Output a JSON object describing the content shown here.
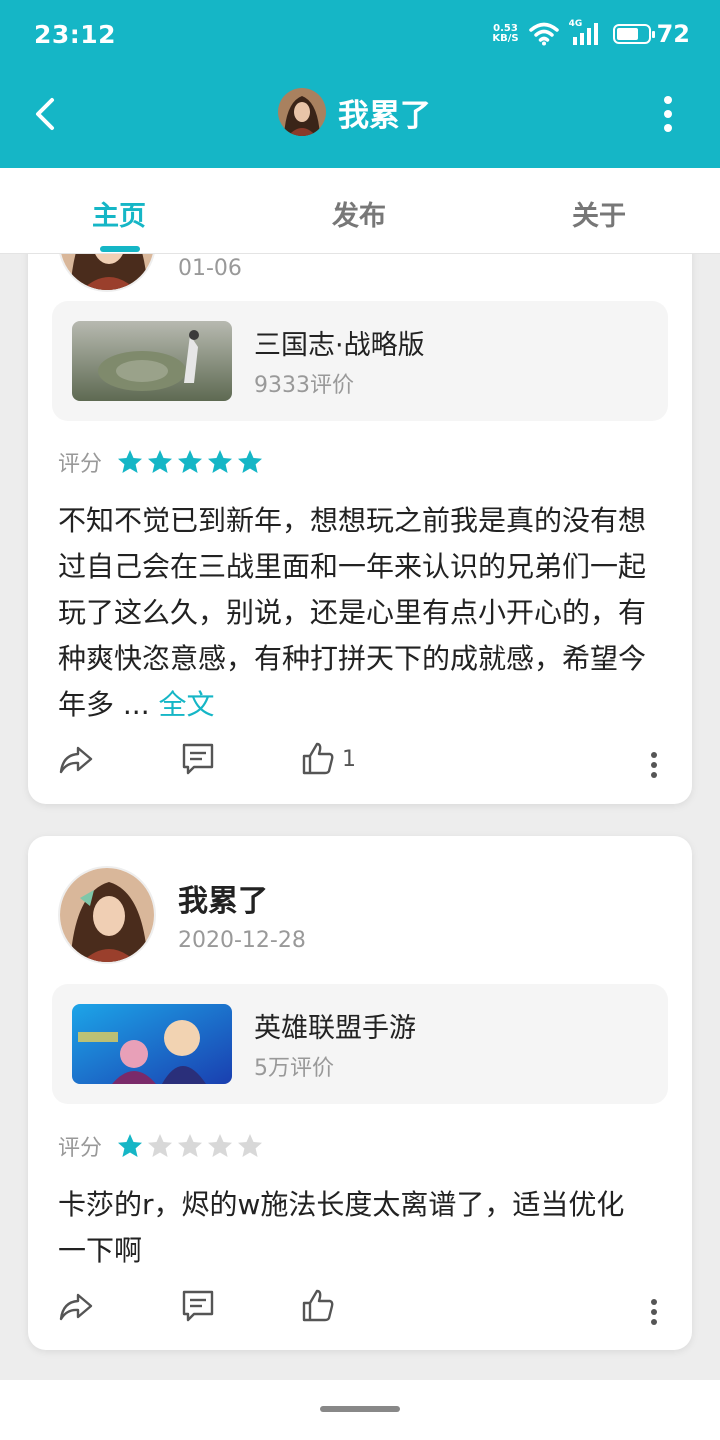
{
  "status_bar": {
    "time": "23:12",
    "net_speed_value": "0.53",
    "net_speed_unit": "KB/S",
    "network_type": "4G",
    "battery": "72",
    "battery_level": 0.72,
    "icons": [
      "wifi-icon",
      "signal-icon",
      "battery-icon"
    ]
  },
  "app_bar": {
    "title": "我累了",
    "icons": [
      "back-arrow-icon",
      "more-vertical-icon"
    ]
  },
  "tabs": [
    {
      "label": "主页",
      "active": true
    },
    {
      "label": "发布",
      "active": false
    },
    {
      "label": "关于",
      "active": false
    }
  ],
  "colors": {
    "accent": "#15b6c6",
    "star_on": "#15b6c6",
    "star_off": "#d8d8d8"
  },
  "posts": [
    {
      "date": "01-06",
      "game": {
        "name": "三国志·战略版",
        "reviews": "9333评价"
      },
      "rating_label": "评分",
      "rating": 5,
      "review_text": "不知不觉已到新年，想想玩之前我是真的没有想过自己会在三战里面和一年来认识的兄弟们一起玩了这么久，别说，还是心里有点小开心的，有种爽快恣意感，有种打拼天下的成就感，希望今年多 ...",
      "more_label": "全文",
      "likes": "1"
    },
    {
      "username": "我累了",
      "date": "2020-12-28",
      "game": {
        "name": "英雄联盟手游",
        "reviews": "5万评价"
      },
      "rating_label": "评分",
      "rating": 1,
      "review_text": "卡莎的r，烬的w施法长度太离谱了，适当优化一下啊",
      "likes": ""
    }
  ]
}
